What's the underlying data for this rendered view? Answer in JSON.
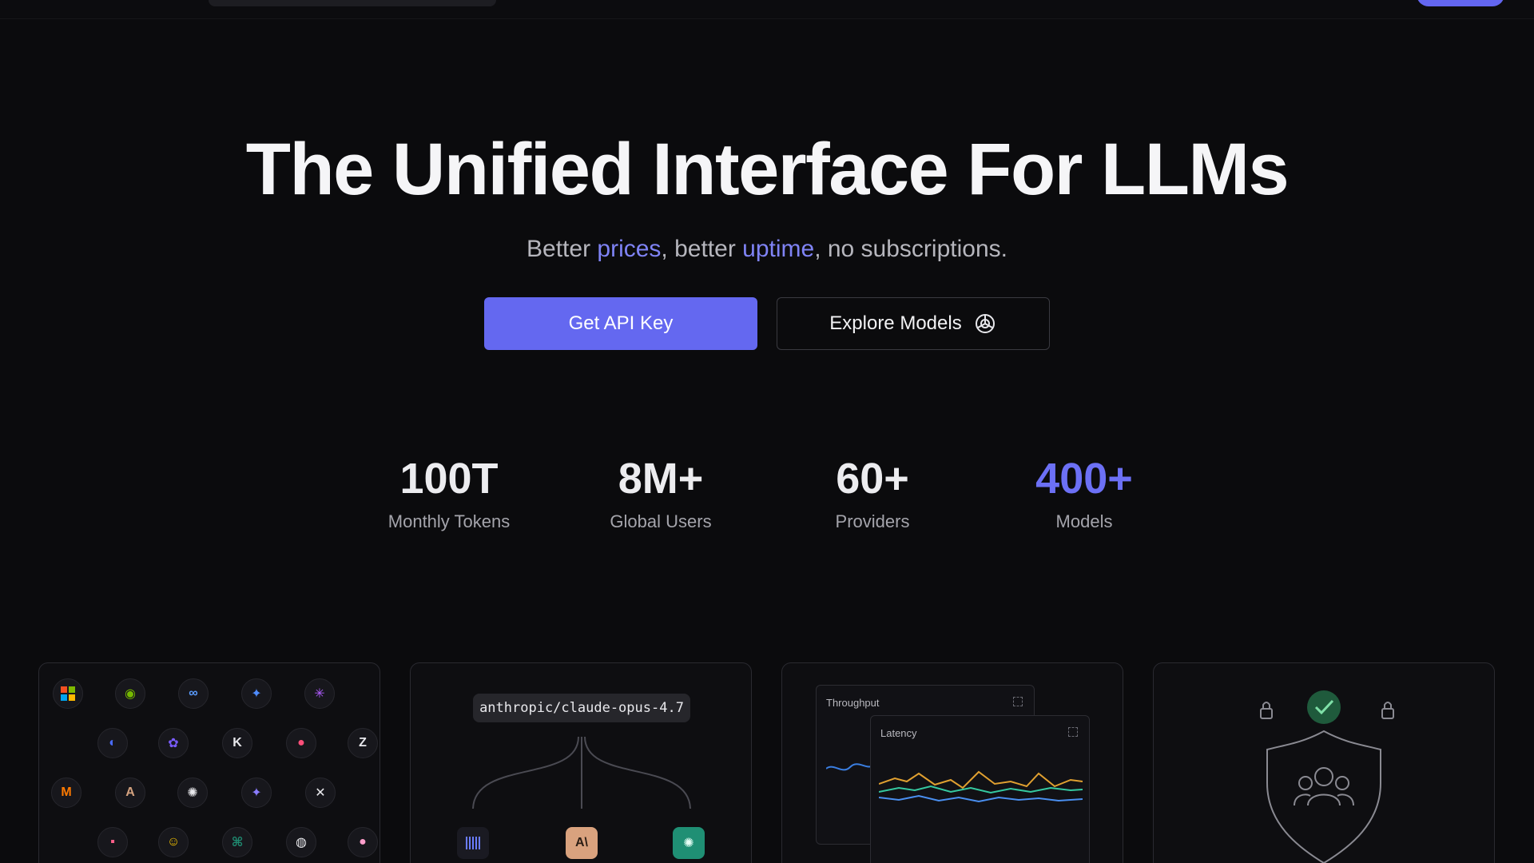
{
  "hero": {
    "title": "The Unified Interface For LLMs",
    "subtitle_parts": [
      "Better ",
      "prices",
      ", better ",
      "uptime",
      ", no subscriptions."
    ]
  },
  "buttons": {
    "primary": "Get API Key",
    "secondary": "Explore Models"
  },
  "stats": [
    {
      "value": "100T",
      "label": "Monthly Tokens"
    },
    {
      "value": "8M+",
      "label": "Global Users"
    },
    {
      "value": "60+",
      "label": "Providers"
    },
    {
      "value": "400+",
      "label": "Models"
    }
  ],
  "cards": {
    "routing": {
      "model": "anthropic/claude-opus-4.7",
      "provider_badge": "A\\"
    },
    "metrics": {
      "throughput": "Throughput",
      "latency": "Latency"
    }
  },
  "colors": {
    "accent": "#6468f0",
    "background": "#0b0b0d"
  },
  "icons": [
    "openai-icon",
    "lock-icon",
    "check-icon",
    "shield-users-icon",
    "expand-icon"
  ]
}
